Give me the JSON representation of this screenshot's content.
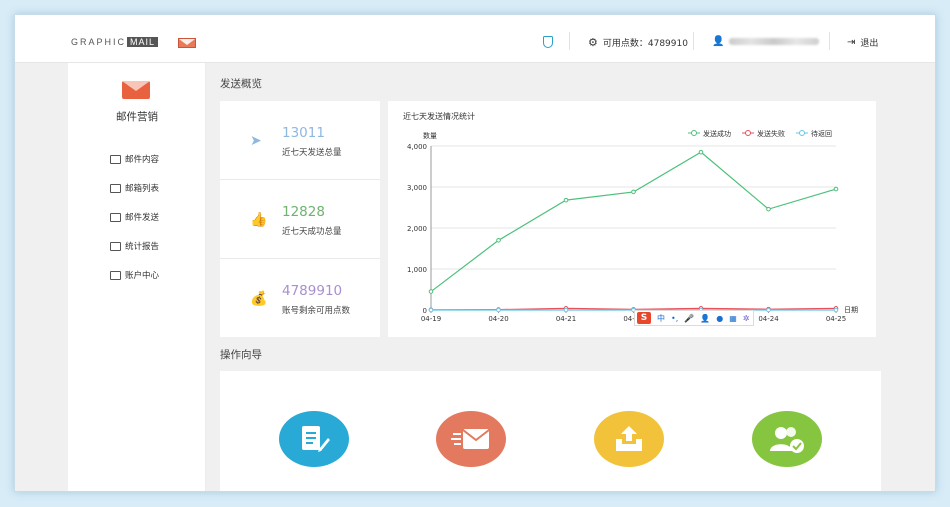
{
  "header": {
    "logo_text": "GRAPHIC",
    "logo_box": "MAIL",
    "points_label": "可用点数：4789910",
    "user_masked": "",
    "logout_label": "退出"
  },
  "sidebar": {
    "title": "邮件营销",
    "items": [
      {
        "label": "邮件内容",
        "icon": "doc-icon"
      },
      {
        "label": "邮箱列表",
        "icon": "list-icon"
      },
      {
        "label": "邮件发送",
        "icon": "send-mail-icon"
      },
      {
        "label": "统计报告",
        "icon": "bar-chart-icon"
      },
      {
        "label": "账户中心",
        "icon": "wallet-icon"
      }
    ]
  },
  "overview": {
    "section_title": "发送概览",
    "stats": [
      {
        "value": "13011",
        "label": "近七天发送总量",
        "color": "#8fb8e0",
        "icon": "paper-plane-icon"
      },
      {
        "value": "12828",
        "label": "近七天成功总量",
        "color": "#6fb36f",
        "icon": "thumbs-up-icon"
      },
      {
        "value": "4789910",
        "label": "账号剩余可用点数",
        "color": "#a98fd0",
        "icon": "money-bag-icon"
      }
    ]
  },
  "chart_data": {
    "type": "line",
    "title": "近七天发送情况统计",
    "ylabel": "数量",
    "xlabel": "日期",
    "categories": [
      "04-19",
      "04-20",
      "04-21",
      "04-22",
      "04-23",
      "04-24",
      "04-25"
    ],
    "ylim": [
      0,
      4000
    ],
    "yticks": [
      "0",
      "1,000",
      "2,000",
      "3,000",
      "4,000"
    ],
    "legend_position": "top-right",
    "grid": true,
    "series": [
      {
        "name": "发送成功",
        "color": "#4cc07a",
        "values": [
          450,
          1700,
          2680,
          2880,
          3850,
          2460,
          2950
        ]
      },
      {
        "name": "发送失败",
        "color": "#e8505b",
        "values": [
          5,
          10,
          40,
          15,
          40,
          20,
          40
        ]
      },
      {
        "name": "待返回",
        "color": "#62c8e8",
        "values": [
          0,
          0,
          0,
          0,
          0,
          0,
          0
        ]
      }
    ]
  },
  "guide": {
    "section_title": "操作向导",
    "items": [
      {
        "icon": "edit-doc-icon",
        "color": "#29a9d6"
      },
      {
        "icon": "fast-mail-icon",
        "color": "#e3795e"
      },
      {
        "icon": "upload-tray-icon",
        "color": "#f2c23a"
      },
      {
        "icon": "users-check-icon",
        "color": "#86c540"
      }
    ]
  },
  "ime": {
    "logo": "S",
    "lang": "中"
  }
}
